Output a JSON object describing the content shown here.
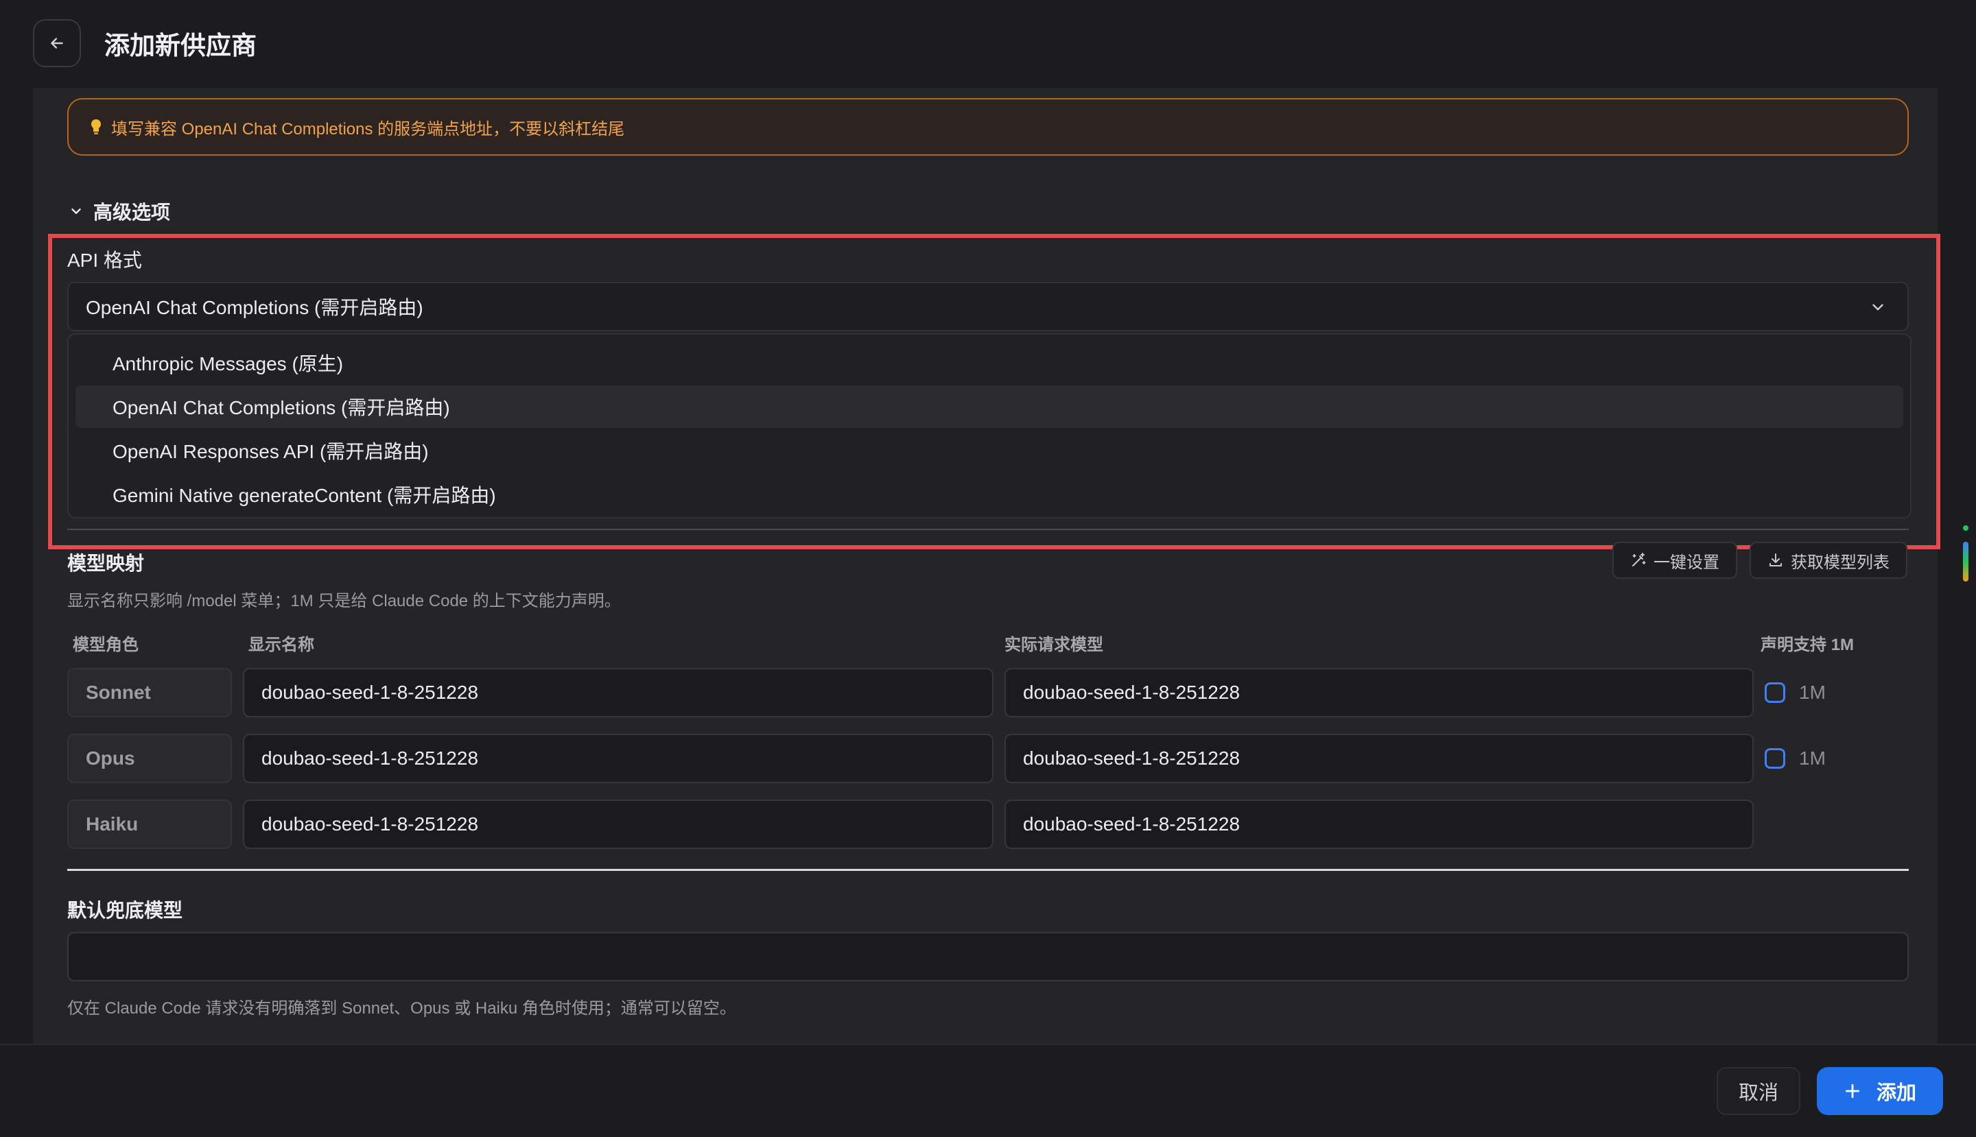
{
  "header": {
    "title": "添加新供应商",
    "back_icon": "arrow-left-icon"
  },
  "hint": {
    "icon": "lightbulb-icon",
    "text": "填写兼容 OpenAI Chat Completions 的服务端点地址，不要以斜杠结尾"
  },
  "advanced": {
    "label": "高级选项",
    "expanded": true
  },
  "api_format": {
    "label": "API 格式",
    "selected": "OpenAI Chat Completions (需开启路由)",
    "options": [
      "Anthropic Messages (原生)",
      "OpenAI Chat Completions (需开启路由)",
      "OpenAI Responses API (需开启路由)",
      "Gemini Native generateContent (需开启路由)"
    ]
  },
  "model_mapping": {
    "title": "模型映射",
    "quick_setup_label": "一键设置",
    "fetch_models_label": "获取模型列表",
    "description": "显示名称只影响 /model 菜单；1M 只是给 Claude Code 的上下文能力声明。",
    "columns": [
      "模型角色",
      "显示名称",
      "实际请求模型",
      "声明支持 1M"
    ],
    "rows": [
      {
        "role": "Sonnet",
        "display_name": "doubao-seed-1-8-251228",
        "actual_model": "doubao-seed-1-8-251228",
        "support_1m_label": "1M",
        "support_1m": false
      },
      {
        "role": "Opus",
        "display_name": "doubao-seed-1-8-251228",
        "actual_model": "doubao-seed-1-8-251228",
        "support_1m_label": "1M",
        "support_1m": false
      },
      {
        "role": "Haiku",
        "display_name": "doubao-seed-1-8-251228",
        "actual_model": "doubao-seed-1-8-251228"
      }
    ]
  },
  "fallback": {
    "title": "默认兜底模型",
    "value": "",
    "description": "仅在 Claude Code 请求没有明确落到 Sonnet、Opus 或 Haiku 角色时使用；通常可以留空。"
  },
  "footer": {
    "cancel_label": "取消",
    "add_label": "添加"
  },
  "colors": {
    "accent": "#1f6feb",
    "warning": "#f2a24c",
    "highlight": "#e5484d"
  }
}
